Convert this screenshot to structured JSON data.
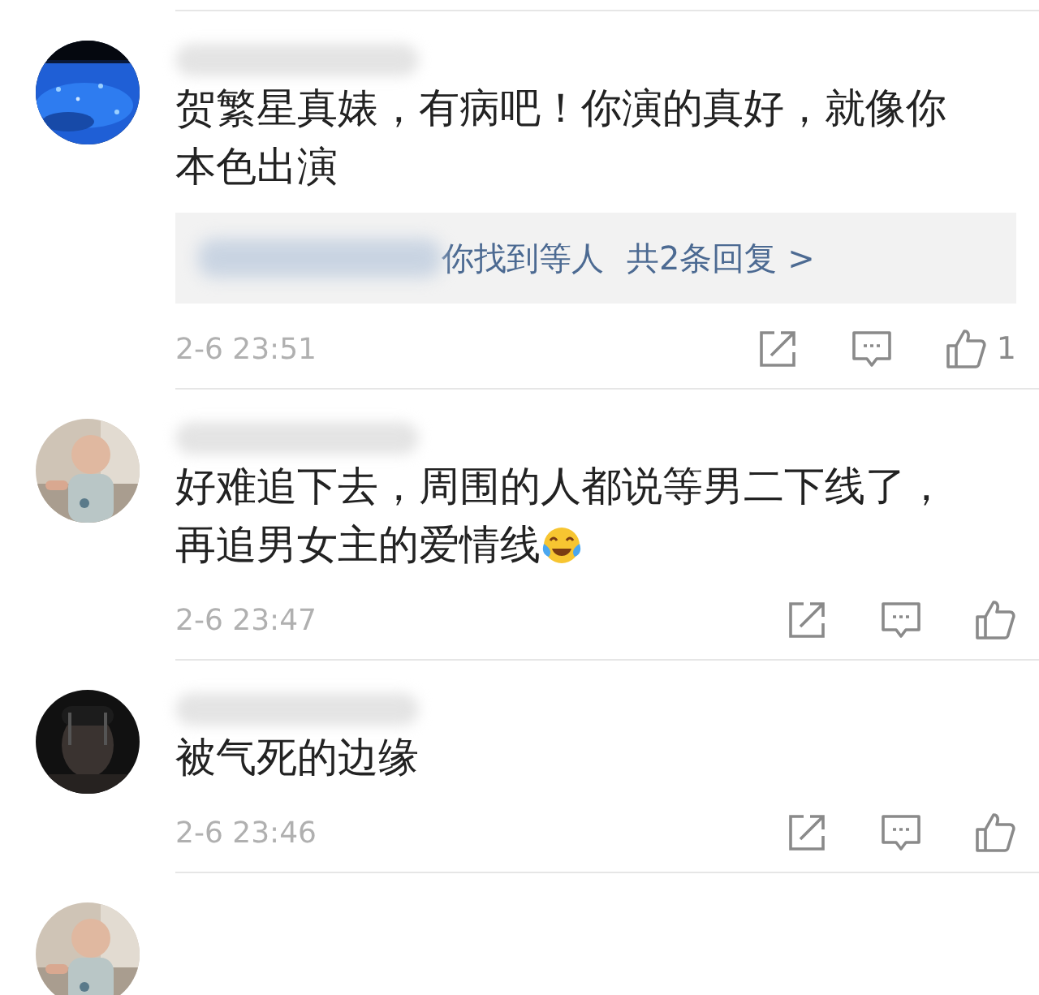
{
  "comments": [
    {
      "avatar": {
        "kind": "picture"
      },
      "text": "贺繁星真婊，有病吧！你演的真好，就像你本色出演",
      "replies": {
        "preview": "你找到等人",
        "more": "共2条回复 >"
      },
      "time": "2-6 23:51",
      "likes": "1"
    },
    {
      "avatar": {
        "kind": "picture"
      },
      "text": "好难追下去，周围的人都说等男二下线了，再追男女主的爱情线",
      "emoji": true,
      "time": "2-6 23:47"
    },
    {
      "avatar": {
        "kind": "picture"
      },
      "text": "被气死的边缘",
      "time": "2-6 23:46"
    },
    {
      "avatar": {
        "kind": "picture"
      }
    }
  ]
}
